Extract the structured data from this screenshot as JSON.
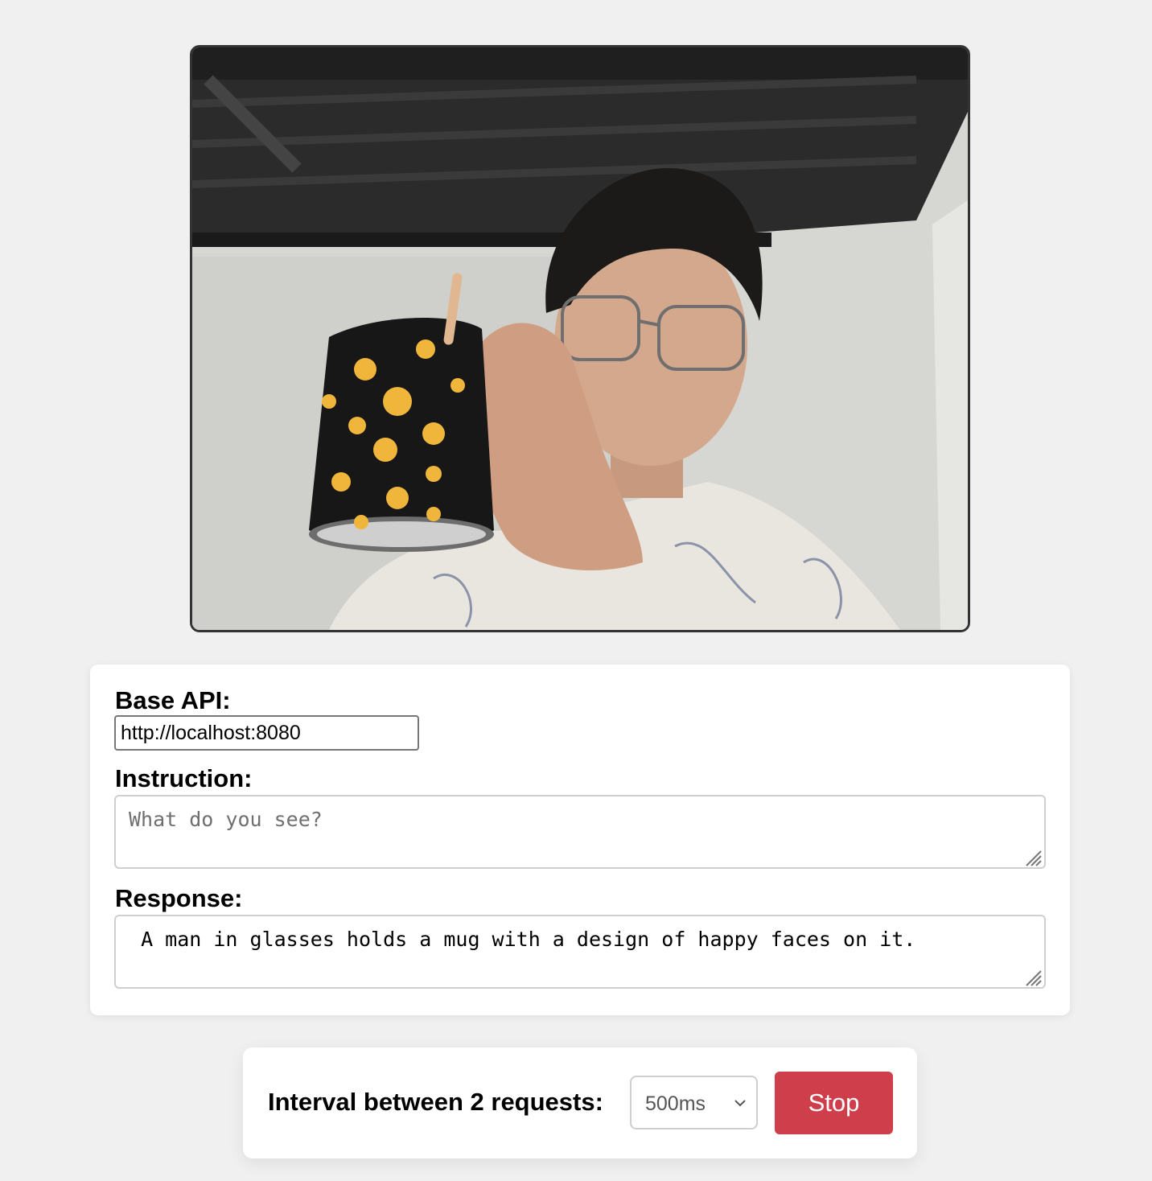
{
  "video": {
    "subject": "webcam-feed"
  },
  "form": {
    "base_api": {
      "label": "Base API:",
      "value": "http://localhost:8080"
    },
    "instruction": {
      "label": "Instruction:",
      "placeholder": "What do you see?",
      "value": ""
    },
    "response": {
      "label": "Response:",
      "value": " A man in glasses holds a mug with a design of happy faces on it."
    }
  },
  "controls": {
    "interval_label": "Interval between 2 requests:",
    "interval_value": "500ms",
    "stop_label": "Stop"
  },
  "colors": {
    "background": "#f0f0f0",
    "stop_button": "#cf3f4b",
    "card": "#ffffff"
  }
}
